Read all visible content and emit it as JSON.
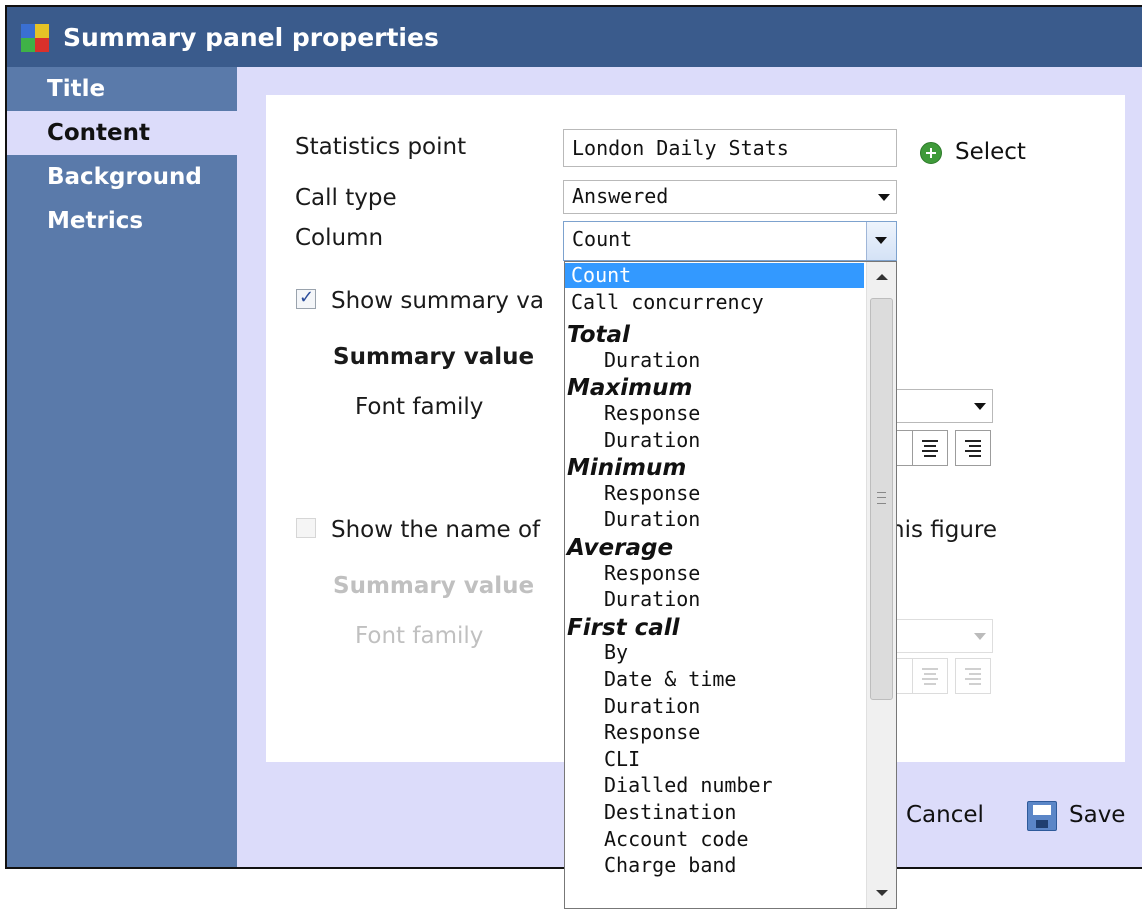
{
  "window": {
    "title": "Summary panel properties"
  },
  "sidebar": {
    "items": [
      {
        "label": "Title",
        "active": false
      },
      {
        "label": "Content",
        "active": true
      },
      {
        "label": "Background",
        "active": false
      },
      {
        "label": "Metrics",
        "active": false
      }
    ]
  },
  "form": {
    "statistics_point": {
      "label": "Statistics point",
      "value": "London Daily Stats",
      "select_label": "Select"
    },
    "call_type": {
      "label": "Call type",
      "value": "Answered"
    },
    "column": {
      "label": "Column",
      "value": "Count"
    },
    "show_summary": {
      "label": "Show summary va",
      "checked": true
    },
    "summary_value_heading": "Summary value",
    "font_family_label": "Font family",
    "show_name": {
      "label": "Show the name of",
      "label_tail": "his figure",
      "checked": false
    },
    "summary_value_dim_heading": "Summary value",
    "font_family_dim_label": "Font family"
  },
  "dropdown": {
    "items": [
      {
        "type": "option",
        "text": "Count",
        "selected": true
      },
      {
        "type": "option",
        "text": "Call concurrency"
      },
      {
        "type": "group",
        "text": "Total"
      },
      {
        "type": "sub",
        "text": "Duration"
      },
      {
        "type": "group",
        "text": "Maximum"
      },
      {
        "type": "sub",
        "text": "Response"
      },
      {
        "type": "sub",
        "text": "Duration"
      },
      {
        "type": "group",
        "text": "Minimum"
      },
      {
        "type": "sub",
        "text": "Response"
      },
      {
        "type": "sub",
        "text": "Duration"
      },
      {
        "type": "group",
        "text": "Average"
      },
      {
        "type": "sub",
        "text": "Response"
      },
      {
        "type": "sub",
        "text": "Duration"
      },
      {
        "type": "group",
        "text": "First call"
      },
      {
        "type": "sub",
        "text": "By"
      },
      {
        "type": "sub",
        "text": "Date & time"
      },
      {
        "type": "sub",
        "text": "Duration"
      },
      {
        "type": "sub",
        "text": "Response"
      },
      {
        "type": "sub",
        "text": "CLI"
      },
      {
        "type": "sub",
        "text": "Dialled number"
      },
      {
        "type": "sub",
        "text": "Destination"
      },
      {
        "type": "sub",
        "text": "Account code"
      },
      {
        "type": "sub",
        "text": "Charge band"
      }
    ]
  },
  "footer": {
    "cancel_label": "Cancel",
    "save_label": "Save"
  },
  "colors": {
    "titlebar": "#3a5b8c",
    "sidebar": "#5a7aaa",
    "highlight": "#3399ff",
    "background": "#dcdcfa"
  },
  "icons": {
    "app": "app-grid-icon",
    "select": "plus-circle-icon",
    "save": "floppy-disk-icon"
  }
}
